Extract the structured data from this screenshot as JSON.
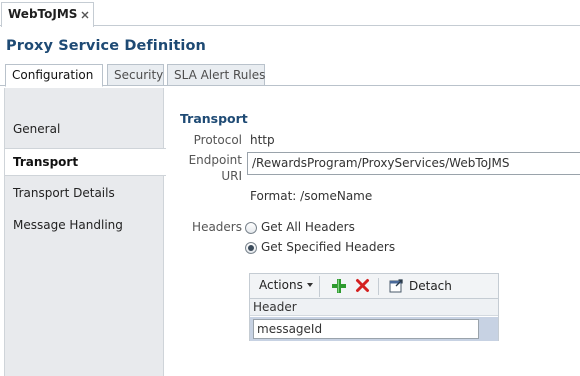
{
  "doc_tab": {
    "label": "WebToJMS"
  },
  "page": {
    "title": "Proxy Service Definition"
  },
  "subtabs": [
    {
      "label": "Configuration",
      "active": true
    },
    {
      "label": "Security",
      "active": false
    },
    {
      "label": "SLA Alert Rules",
      "active": false
    }
  ],
  "nav": {
    "items": [
      {
        "label": "General",
        "selected": false
      },
      {
        "label": "Transport",
        "selected": true
      },
      {
        "label": "Transport Details",
        "selected": false
      },
      {
        "label": "Message Handling",
        "selected": false
      }
    ]
  },
  "transport": {
    "section_title": "Transport",
    "protocol_label": "Protocol",
    "protocol_value": "http",
    "endpoint_label_line1": "Endpoint",
    "endpoint_label_line2": "URI",
    "endpoint_value": "/RewardsProgram/ProxyServices/WebToJMS",
    "format_hint": "Format: /someName",
    "headers_label": "Headers",
    "headers_options": [
      {
        "label": "Get All Headers",
        "checked": false
      },
      {
        "label": "Get Specified Headers",
        "checked": true
      }
    ]
  },
  "headers_table": {
    "actions_label": "Actions",
    "detach_label": "Detach",
    "column_header": "Header",
    "rows": [
      {
        "header": "messageId"
      }
    ]
  },
  "icons": {
    "close": "close-icon",
    "add": "add-icon",
    "delete": "delete-icon",
    "detach": "detach-icon",
    "caret": "caret-down-icon"
  },
  "colors": {
    "title_blue": "#1e4a74",
    "nav_bg": "#e8eaed",
    "selected_row": "#c7d2e3",
    "add_green": "#2e9a2e",
    "delete_red": "#d42020"
  }
}
